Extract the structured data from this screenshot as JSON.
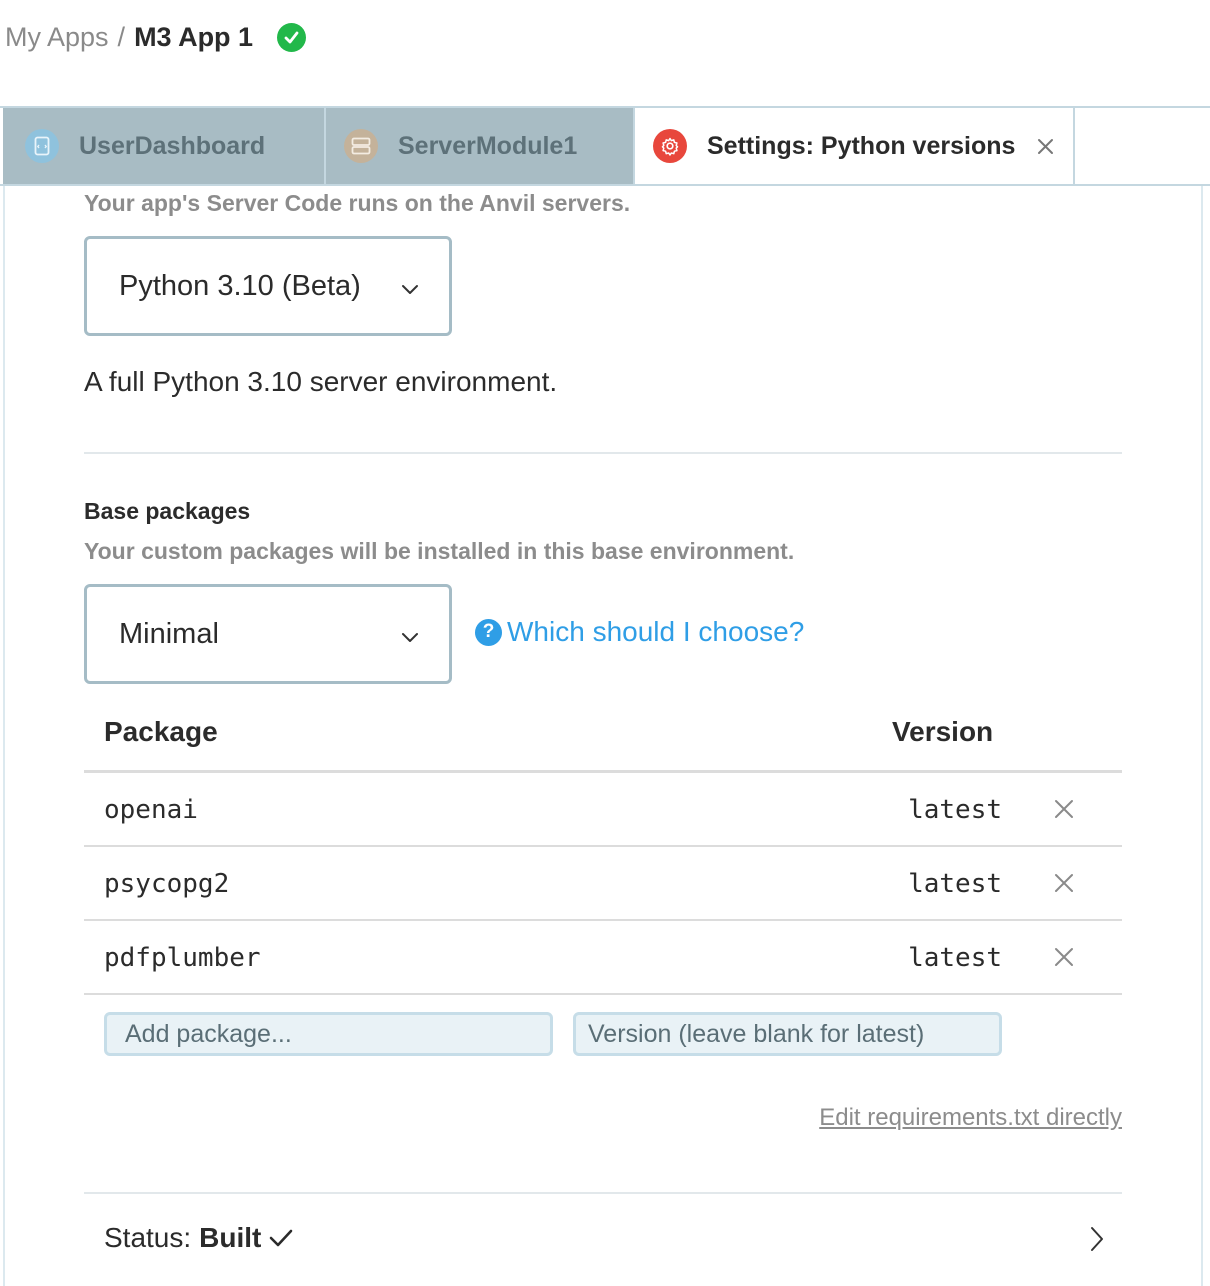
{
  "breadcrumb": {
    "parent": "My Apps",
    "separator": "/",
    "current": "M3 App 1",
    "status_icon": "check-circle-icon",
    "status_color": "#22b84a"
  },
  "tabs": [
    {
      "label": "UserDashboard",
      "icon": "form-icon",
      "active": false
    },
    {
      "label": "ServerModule1",
      "icon": "server-icon",
      "active": false
    },
    {
      "label": "Settings: Python versions",
      "icon": "gear-icon",
      "active": true,
      "closable": true
    }
  ],
  "server": {
    "help_text": "Your app's Server Code runs on the Anvil servers.",
    "python_version": "Python 3.10 (Beta)",
    "description": "A full Python 3.10 server environment."
  },
  "base_packages": {
    "title": "Base packages",
    "help_text": "Your custom packages will be installed in this base environment.",
    "selected": "Minimal",
    "help_link": "Which should I choose?"
  },
  "packages_table": {
    "columns": [
      "Package",
      "Version"
    ],
    "rows": [
      {
        "package": "openai",
        "version": "latest"
      },
      {
        "package": "psycopg2",
        "version": "latest"
      },
      {
        "package": "pdfplumber",
        "version": "latest"
      }
    ],
    "add_package_placeholder": "Add package...",
    "version_placeholder": "Version (leave blank for latest)"
  },
  "edit_requirements_link": "Edit requirements.txt directly",
  "status": {
    "label": "Status:",
    "value": "Built"
  },
  "colors": {
    "accent_link": "#2f9ee6",
    "settings_icon": "#e8473c",
    "inactive_tab": "#a8bcc4"
  }
}
